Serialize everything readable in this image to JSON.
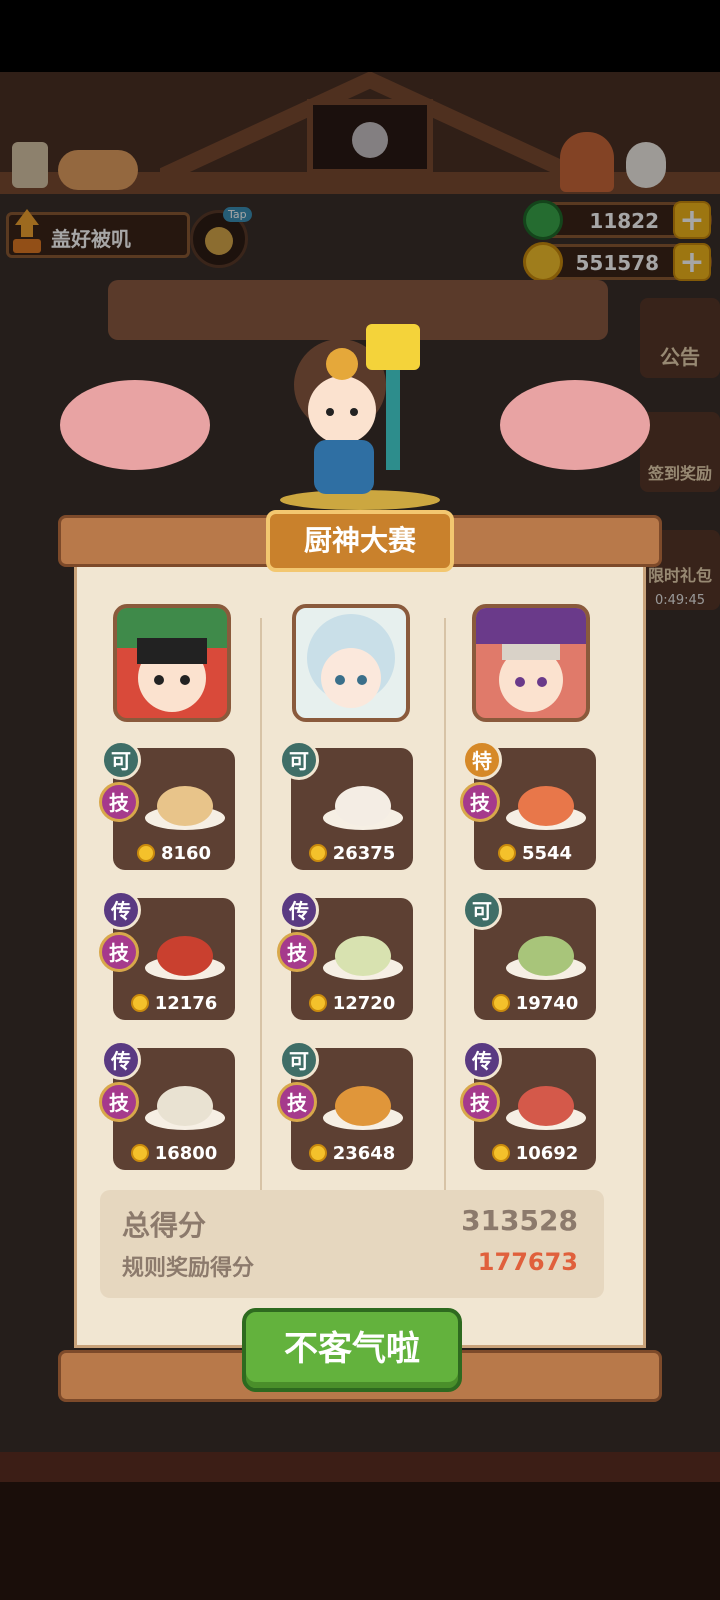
{
  "player": {
    "name": "盖好被叽",
    "tap_label": "Tap"
  },
  "resources": {
    "jade": "11822",
    "coins": "551578",
    "plus": "+"
  },
  "side_buttons": {
    "notice": "公告",
    "checkin": "签到奖励",
    "gift": "限时礼包",
    "timer": "0:49:45"
  },
  "contest": {
    "title": "厨神大赛",
    "columns": [
      {
        "portrait": "chef-opera-portrait",
        "dishes": [
          {
            "badge": "可",
            "badge_type": "ke",
            "skill": "技",
            "price": "8160",
            "icon": "tempura-plate-icon"
          },
          {
            "badge": "传",
            "badge_type": "chuan",
            "skill": "技",
            "price": "12176",
            "icon": "braised-meat-icon"
          },
          {
            "badge": "传",
            "badge_type": "chuan",
            "skill": "技",
            "price": "16800",
            "icon": "scroll-dumpling-icon"
          }
        ]
      },
      {
        "portrait": "chef-snow-portrait",
        "dishes": [
          {
            "badge": "可",
            "badge_type": "ke",
            "skill": "",
            "price": "26375",
            "icon": "fruit-cake-icon"
          },
          {
            "badge": "传",
            "badge_type": "chuan",
            "skill": "技",
            "price": "12720",
            "icon": "dumpling-plate-icon"
          },
          {
            "badge": "可",
            "badge_type": "ke",
            "skill": "技",
            "price": "23648",
            "icon": "gourd-pastry-icon"
          }
        ]
      },
      {
        "portrait": "chef-lion-portrait",
        "dishes": [
          {
            "badge": "特",
            "badge_type": "te",
            "skill": "技",
            "price": "5544",
            "icon": "soup-bowl-icon"
          },
          {
            "badge": "可",
            "badge_type": "ke",
            "skill": "",
            "price": "19740",
            "icon": "layer-cake-icon"
          },
          {
            "badge": "传",
            "badge_type": "chuan",
            "skill": "技",
            "price": "10692",
            "icon": "roast-platter-icon"
          }
        ]
      }
    ],
    "total_label": "总得分",
    "total_value": "313528",
    "bonus_label": "规则奖励得分",
    "bonus_value": "177673",
    "confirm_label": "不客气啦"
  },
  "colors": {
    "accent_green": "#63b23d",
    "bonus_red": "#e0603c",
    "total_brown": "#8c7a6c"
  }
}
